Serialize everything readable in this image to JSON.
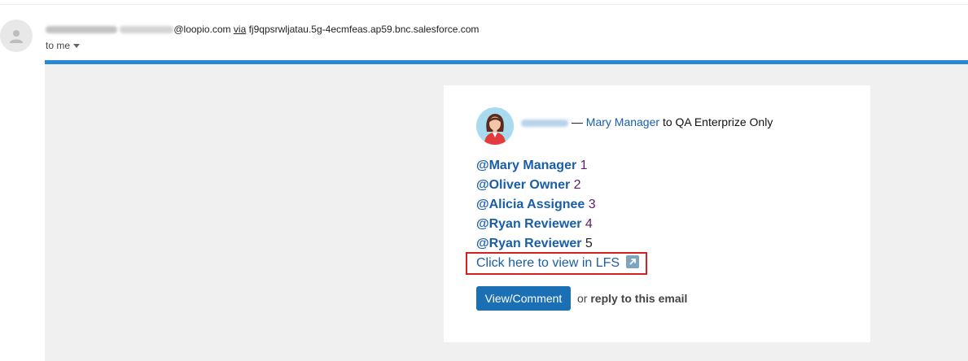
{
  "email": {
    "sender_domain": "@loopio.com",
    "via_label": "via",
    "via_address": "fj9qpsrwljatau.5g-4ecmfeas.ap59.bnc.salesforce.com",
    "recipient_label": "to me"
  },
  "notification": {
    "actor_link": "Mary Manager",
    "separator": "—",
    "target_text": "to QA Enterprize Only",
    "mentions": [
      {
        "name": "@Mary Manager",
        "number": "1"
      },
      {
        "name": "@Oliver Owner",
        "number": "2"
      },
      {
        "name": "@Alicia Assignee",
        "number": "3"
      },
      {
        "name": "@Ryan Reviewer",
        "number": "4"
      },
      {
        "name": "@Ryan Reviewer",
        "number": "5"
      }
    ],
    "lfs_link": "Click here to view in LFS",
    "view_button": "View/Comment",
    "reply_or": "or",
    "reply_action": "reply to this email"
  },
  "colors": {
    "accent_bar": "#2a88d3",
    "link": "#1a5ea8",
    "button": "#1b6fb4",
    "highlight_box": "#d42020"
  }
}
